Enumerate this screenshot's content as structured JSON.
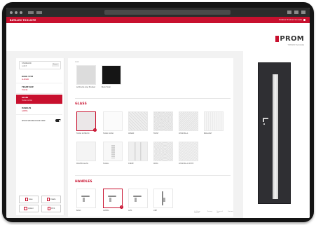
{
  "app": {
    "title": "BATALEX TOOLSITE",
    "user_label": "Batalex Prostred tool.site"
  },
  "brand": {
    "name": "PROM",
    "tagline": "THE BEST IN DOORS",
    "accent_color": "#c8102e"
  },
  "sidebar": {
    "selector": {
      "line1": "STANDARD",
      "line2": "LANCE",
      "button": "Zmeni"
    },
    "items": [
      {
        "name": "DOOR TYPE",
        "value": "ALLEGRO",
        "active": false
      },
      {
        "name": "FRAME SIZE",
        "value": "70x196",
        "active": false
      },
      {
        "name": "GLASS",
        "value": "FLORA CLEAR",
        "active": true
      },
      {
        "name": "HANDLES",
        "value": "GAMMA",
        "active": false
      }
    ],
    "toggle_label": "SHOW SECOND DOOR VIEW",
    "buttons": [
      {
        "label": "Save"
      },
      {
        "label": "Delete"
      },
      {
        "label": "Upload"
      },
      {
        "label": "Print"
      }
    ]
  },
  "content": {
    "color_section_label": "Color",
    "colors": [
      {
        "label": "Anthracite Grey Brushed"
      },
      {
        "label": "Black Finish"
      }
    ],
    "glass_title": "GLASS",
    "glass": [
      {
        "label": "FLORA SATINATO",
        "selected": true
      },
      {
        "label": "FLORA CLEAR",
        "selected": false
      },
      {
        "label": "ORNAM",
        "selected": false
      },
      {
        "label": "FROST",
        "selected": false
      },
      {
        "label": "CHINCHILLA",
        "selected": false
      },
      {
        "label": "BRILLIANT",
        "selected": false
      },
      {
        "label": "MASTER GLASS",
        "selected": false
      },
      {
        "label": "FLORAL",
        "selected": false
      },
      {
        "label": "STRIPE",
        "selected": false
      },
      {
        "label": "DELTA",
        "selected": false
      },
      {
        "label": "CHINCHILLA WHITE",
        "selected": false
      }
    ],
    "handles_title": "HANDLES",
    "handles": [
      {
        "label": "BASIC",
        "selected": false
      },
      {
        "label": "GAMMA",
        "selected": true
      },
      {
        "label": "ALFA",
        "selected": false
      },
      {
        "label": "LINE",
        "selected": false
      }
    ],
    "footer": [
      "(c) Prom Toolsite",
      "Privacy",
      "Terms of use",
      "Contact"
    ]
  }
}
